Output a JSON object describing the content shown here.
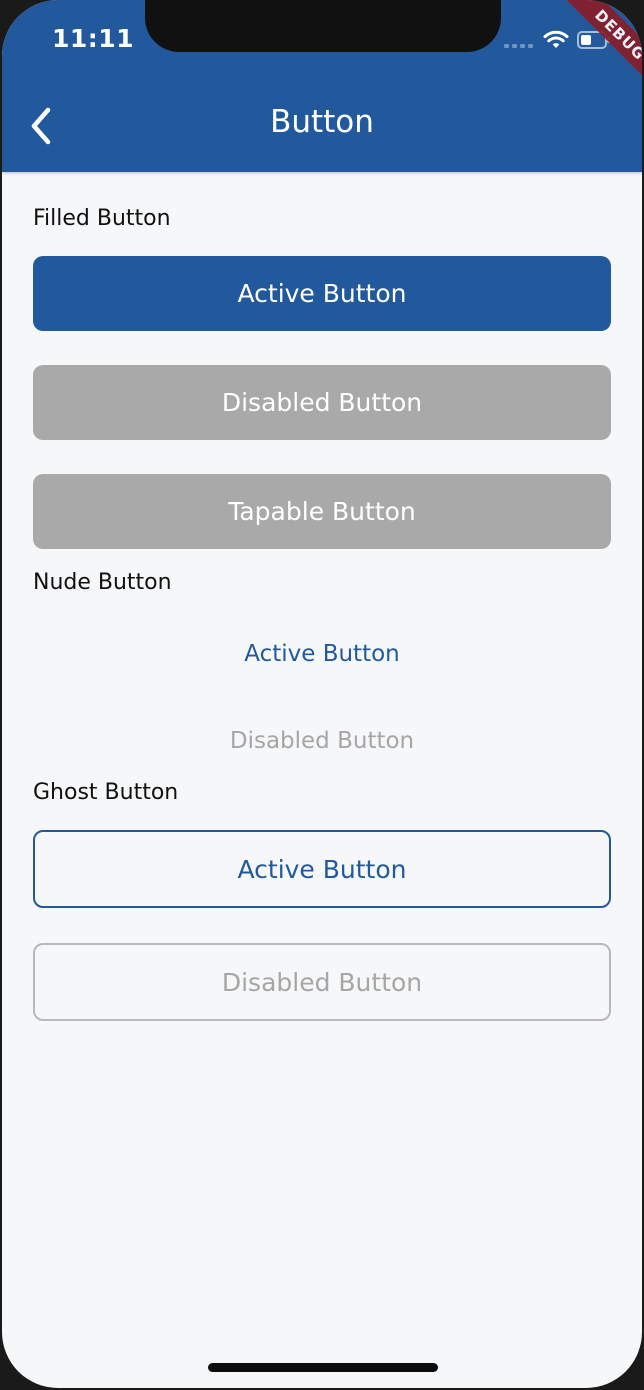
{
  "status_bar": {
    "time": "11:11",
    "debug_banner": "DEBUG"
  },
  "app_bar": {
    "title": "Button",
    "back_icon": "chevron-left-icon"
  },
  "sections": {
    "filled": {
      "label": "Filled Button",
      "active": "Active Button",
      "disabled": "Disabled Button",
      "tapable": "Tapable Button"
    },
    "nude": {
      "label": "Nude Button",
      "active": "Active Button",
      "disabled": "Disabled Button"
    },
    "ghost": {
      "label": "Ghost Button",
      "active": "Active Button",
      "disabled": "Disabled Button"
    }
  },
  "colors": {
    "primary": "#22599c",
    "disabled_fill": "#a9a9a9",
    "disabled_text": "#a6a6a6",
    "background": "#f6f7f9",
    "debug_ribbon": "#8a1e2b"
  }
}
